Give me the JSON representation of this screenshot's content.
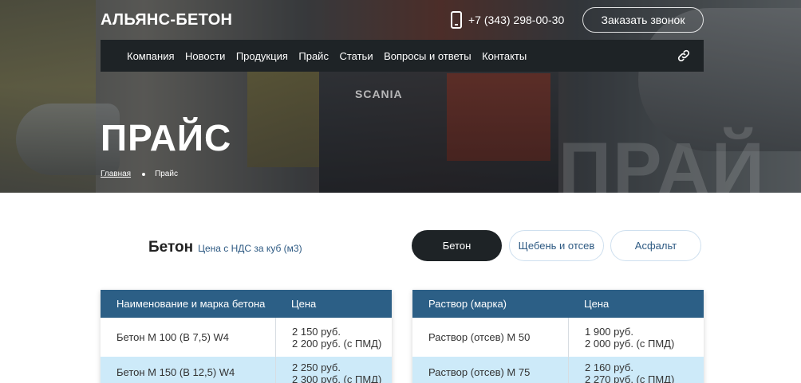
{
  "header": {
    "logo": "АЛЬЯНС-БЕТОН",
    "phone": "+7 (343) 298-00-30",
    "callback_label": "Заказать звонок"
  },
  "nav": {
    "items": [
      "Компания",
      "Новости",
      "Продукция",
      "Прайс",
      "Статьи",
      "Вопросы и ответы",
      "Контакты"
    ]
  },
  "hero": {
    "title": "ПРАЙС",
    "watermark": "ПРАЙ",
    "truck_brand": "SCANIA",
    "breadcrumb": {
      "home": "Главная",
      "current": "Прайс"
    }
  },
  "price": {
    "title": "Бетон",
    "subtitle": "Цена с НДС за куб (м3)",
    "tabs": [
      "Бетон",
      "Щебень и отсев",
      "Асфальт"
    ],
    "active_tab": "Бетон"
  },
  "table_left": {
    "headers": [
      "Наименование и марка бетона",
      "Цена"
    ],
    "rows": [
      {
        "name": "Бетон М 100 (В 7,5) W4",
        "price1": "2 150 руб.",
        "price2": "2 200 руб. (с ПМД)"
      },
      {
        "name": "Бетон М 150 (В 12,5) W4",
        "price1": "2 250 руб.",
        "price2": "2 300 руб. (с ПМД)"
      }
    ]
  },
  "table_right": {
    "headers": [
      "Раствор (марка)",
      "Цена"
    ],
    "rows": [
      {
        "name": "Раствор (отсев) М 50",
        "price1": "1 900 руб.",
        "price2": "2 000 руб. (с ПМД)"
      },
      {
        "name": "Раствор (отсев) М 75",
        "price1": "2 160 руб.",
        "price2": "2 270 руб. (с ПМД)"
      }
    ]
  },
  "colors": {
    "nav_bg": "#1e2326",
    "table_header": "#2c5f86",
    "row_highlight": "#cdeaf9",
    "accent_text": "#2e5a83"
  },
  "icons": {
    "phone": "phone-icon",
    "link": "link-icon"
  }
}
